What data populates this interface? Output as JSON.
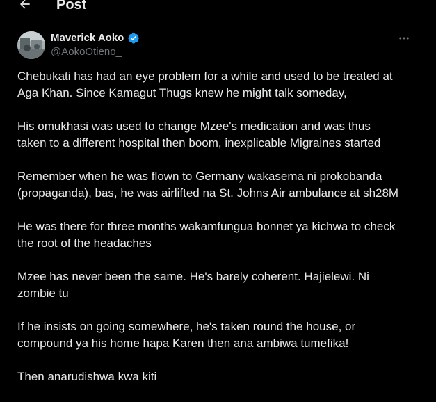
{
  "header": {
    "title": "Post",
    "back_icon": "arrow-left-icon"
  },
  "post": {
    "author": {
      "name": "Maverick Aoko",
      "handle": "@AokoOtieno_",
      "verified": true,
      "verified_color": "#1d9bf0"
    },
    "more_icon": "more-horizontal-icon",
    "paragraphs": [
      "Chebukati has had an eye problem for a while and used to be treated at\nAga Khan. Since Kamagut Thugs knew he might talk someday,",
      "His omukhasi was used to change Mzee's medication and was thus\ntaken to a different hospital then boom, inexplicable Migraines started",
      "Remember when he was flown to Germany wakasema ni prokobanda\n(propaganda), bas, he was airlifted na St. Johns Air ambulance at sh28M",
      "He was there for three months wakamfungua bonnet ya kichwa to check\nthe root of the headaches",
      "Mzee has never been the same. He's barely coherent. Hajielewi. Ni\nzombie tu",
      "If he insists on going somewhere, he's taken round the house, or\ncompound ya his home hapa Karen then ana ambiwa tumefika!",
      "Then anarudishwa kwa kiti"
    ]
  },
  "colors": {
    "background": "#000000",
    "text_primary": "#e7e9ea",
    "text_secondary": "#71767b",
    "border": "#2f3336",
    "accent": "#1d9bf0"
  }
}
